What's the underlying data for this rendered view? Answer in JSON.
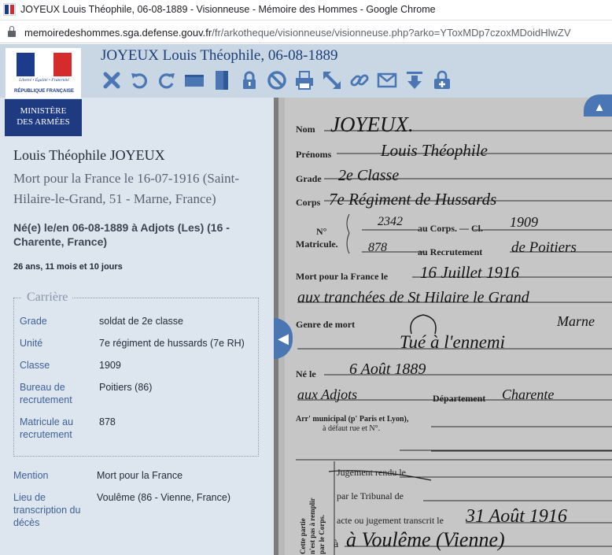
{
  "browser": {
    "tab_title": "JOYEUX Louis Théophile, 06-08-1889 - Visionneuse - Mémoire des Hommes - Google Chrome",
    "url_domain": "memoiredeshommes.sga.defense.gouv.fr",
    "url_path": "/fr/arkotheque/visionneuse/visionneuse.php?arko=YToxMDp7czoxMDoidHlwZV"
  },
  "logo": {
    "motto": "Liberté • Égalité • Fraternité",
    "republic": "RÉPUBLIQUE FRANÇAISE",
    "ministry_line1": "MINISTÈRE",
    "ministry_line2": "DES ARMÉES"
  },
  "header": {
    "title": "JOYEUX Louis Théophile, 06-08-1889"
  },
  "toolbar": {
    "icons": [
      "close-icon",
      "rotate-left-icon",
      "rotate-right-icon",
      "fit-width-icon",
      "fit-height-icon",
      "lock-icon",
      "forbidden-icon",
      "print-icon",
      "fullscreen-icon",
      "link-icon",
      "mail-icon",
      "download-icon",
      "add-basket-icon"
    ]
  },
  "person": {
    "full_name": "Louis Théophile JOYEUX",
    "death": "Mort pour la France le 16-07-1916 (Saint-Hilaire-le-Grand, 51 - Marne, France)",
    "birth": "Né(e) le/en 06-08-1889 à Adjots (Les) (16 - Charente, France)",
    "age": "26 ans, 11 mois et 10 jours"
  },
  "carriere": {
    "legend": "Carrière",
    "rows": [
      {
        "label": "Grade",
        "value": "soldat de 2e classe"
      },
      {
        "label": "Unité",
        "value": "7e régiment de hussards (7e RH)"
      },
      {
        "label": "Classe",
        "value": "1909"
      },
      {
        "label": "Bureau de recrutement",
        "value": "Poitiers (86)"
      },
      {
        "label": "Matricule au recrutement",
        "value": "878"
      }
    ]
  },
  "extra": [
    {
      "label": "Mention",
      "value": "Mort pour la France"
    },
    {
      "label": "Lieu de transcription du décès",
      "value": "Voulême (86 - Vienne, France)"
    }
  ],
  "document": {
    "nom_label": "Nom",
    "nom": "JOYEUX.",
    "prenoms_label": "Prénoms",
    "prenoms": "Louis Théophile",
    "grade_label": "Grade",
    "grade": "2e Classe",
    "corps_label": "Corps",
    "corps": "7e Régiment de Hussards",
    "no_label": "N°",
    "matricule_label": "Matricule.",
    "au_corps_label": "au Corps. — Cl.",
    "corps_number": "2342",
    "classe": "1909",
    "au_recrutement_label": "au Recrutement",
    "recrutement_number": "878",
    "recrutement_place": "de Poitiers",
    "mort_label": "Mort pour la France le",
    "mort_date": "16 Juillet 1916",
    "mort_lieu": "aux tranchées de St Hilaire le Grand",
    "marne": "Marne",
    "genre_label": "Genre de mort",
    "genre": "Tué à l'ennemi",
    "ne_label": "Né le",
    "ne_date": "6 Août 1889",
    "ne_lieu": "aux Adjots",
    "departement_label": "Département",
    "departement": "Charente",
    "arr_label": "Arr' municipal (p' Paris et Lyon),",
    "arr_label2": "à défaut rue et N°.",
    "side_label1": "Cette partie",
    "side_label2": "n'est pas à remplir",
    "side_label3": "par le Corps.",
    "jugement_label": "Jugement rendu le",
    "tribunal_label": "par le Tribunal de",
    "acte_label": "acte ou jugement transcrit le",
    "acte_date": "31 Août 1916",
    "acte_lieu": "à Voulême (Vienne)"
  },
  "colors": {
    "header_bg": "#c9d6e3",
    "panel_bg": "#dde5ee",
    "toolbar_icon": "#4a77b4",
    "accent": "#1e3a80"
  }
}
